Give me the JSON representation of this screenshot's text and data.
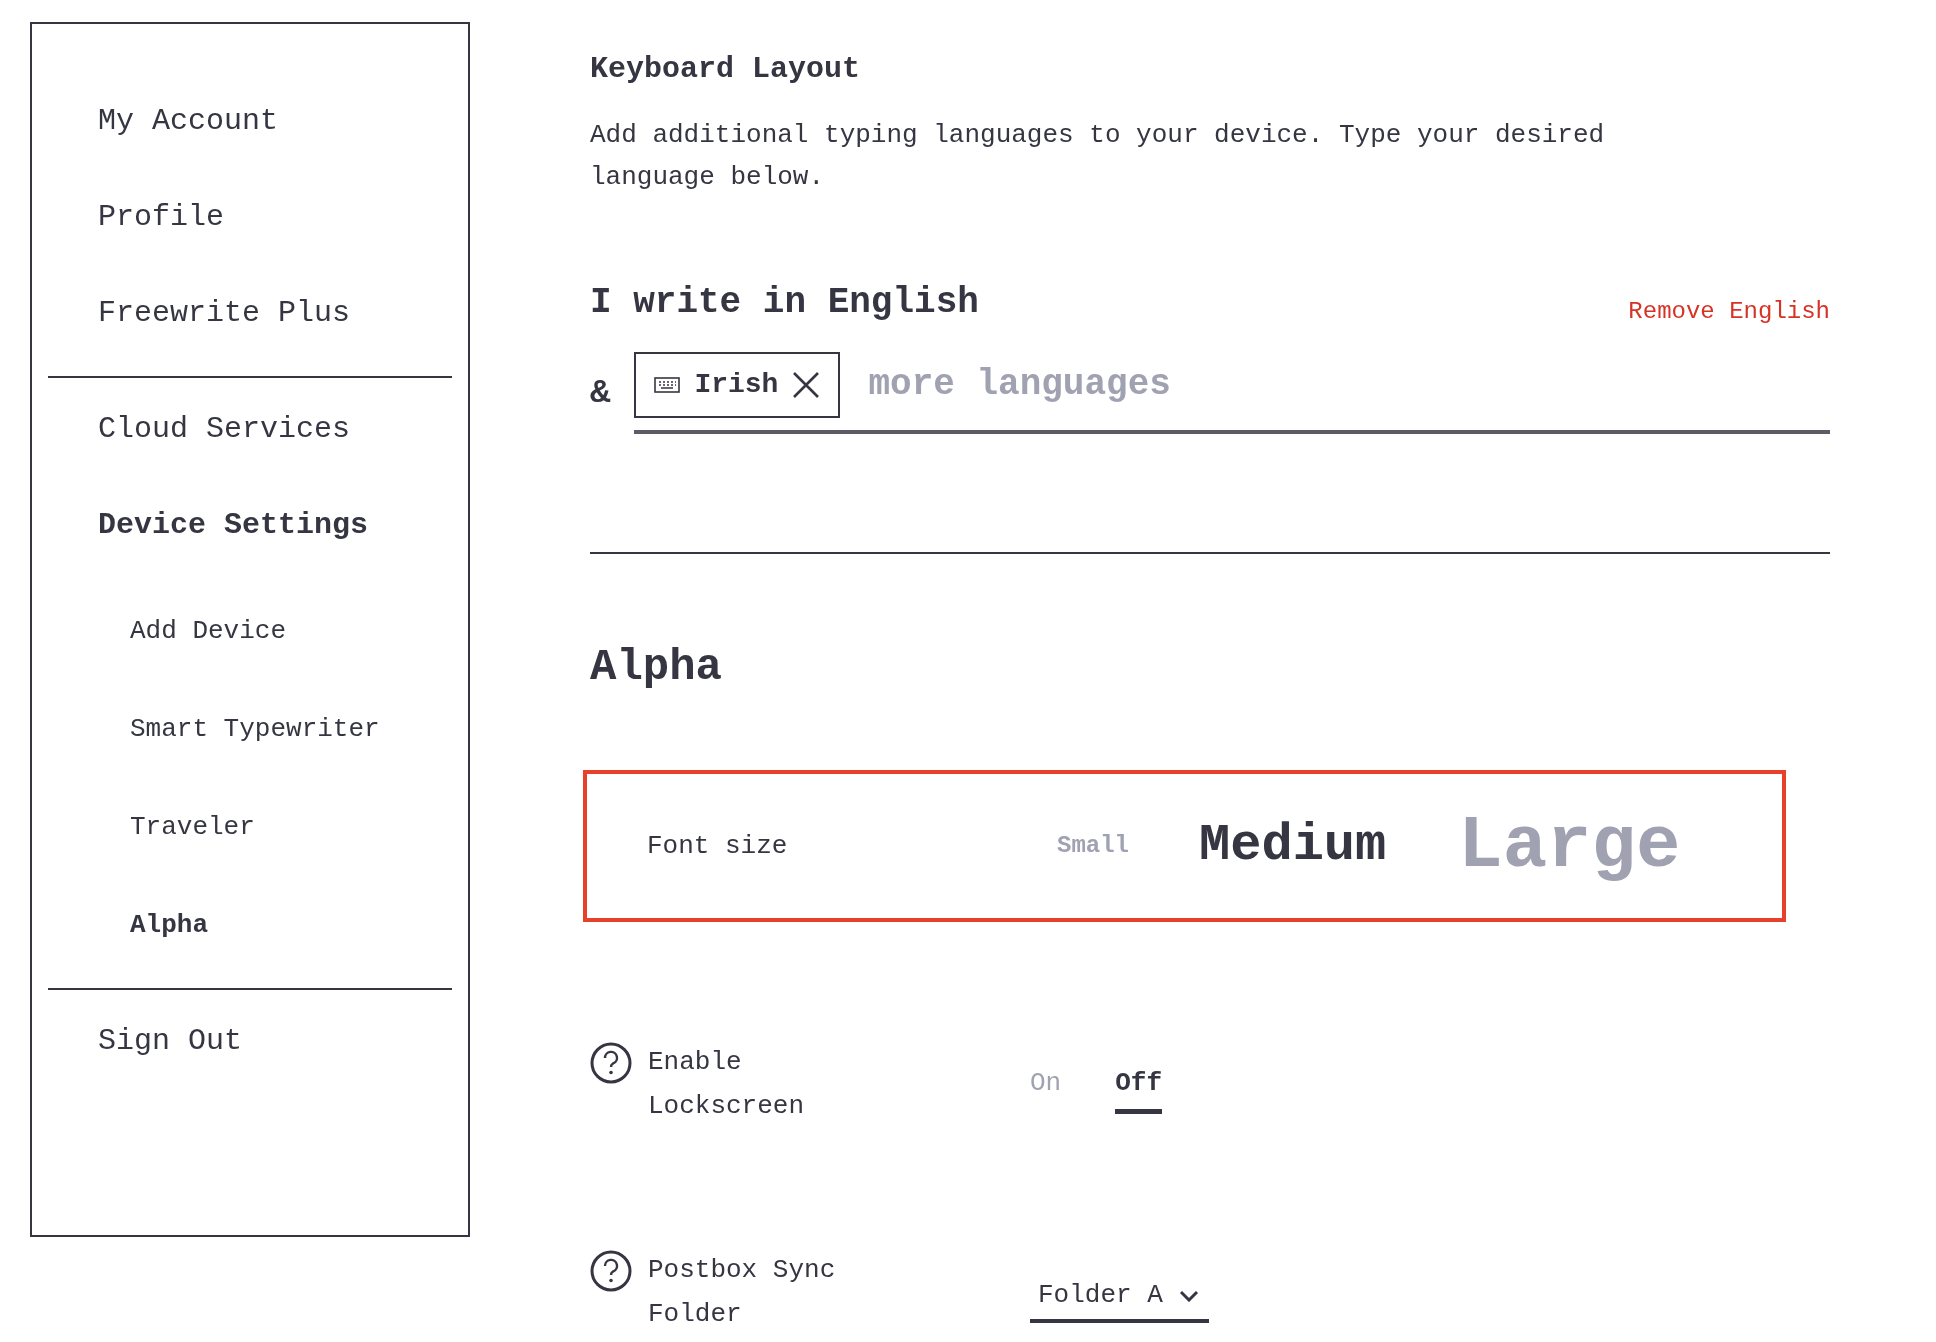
{
  "sidebar": {
    "groups": [
      {
        "items": [
          {
            "label": "My Account",
            "selected": false
          },
          {
            "label": "Profile",
            "selected": false
          },
          {
            "label": "Freewrite Plus",
            "selected": false
          }
        ]
      },
      {
        "items": [
          {
            "label": "Cloud Services",
            "selected": false
          },
          {
            "label": "Device Settings",
            "selected": true,
            "children": [
              {
                "label": "Add Device",
                "selected": false
              },
              {
                "label": "Smart Typewriter",
                "selected": false
              },
              {
                "label": "Traveler",
                "selected": false
              },
              {
                "label": "Alpha",
                "selected": true
              }
            ]
          }
        ]
      },
      {
        "items": [
          {
            "label": "Sign Out",
            "selected": false
          }
        ]
      }
    ]
  },
  "keyboard": {
    "title": "Keyboard Layout",
    "description": "Add additional typing languages to your device. Type your desired language below.",
    "primary": "I write in English",
    "remove_link": "Remove English",
    "ampersand": "&",
    "chips": [
      {
        "label": "Irish"
      }
    ],
    "placeholder": "more languages"
  },
  "device": {
    "title": "Alpha",
    "font_size": {
      "label": "Font size",
      "options": [
        {
          "label": "Small",
          "selected": false
        },
        {
          "label": "Medium",
          "selected": true
        },
        {
          "label": "Large",
          "selected": false
        }
      ]
    },
    "settings": [
      {
        "kind": "toggle",
        "label": "Enable Lockscreen",
        "options": [
          {
            "label": "On",
            "selected": false
          },
          {
            "label": "Off",
            "selected": true
          }
        ]
      },
      {
        "kind": "dropdown",
        "label": "Postbox Sync Folder",
        "value": "Folder A"
      }
    ]
  }
}
